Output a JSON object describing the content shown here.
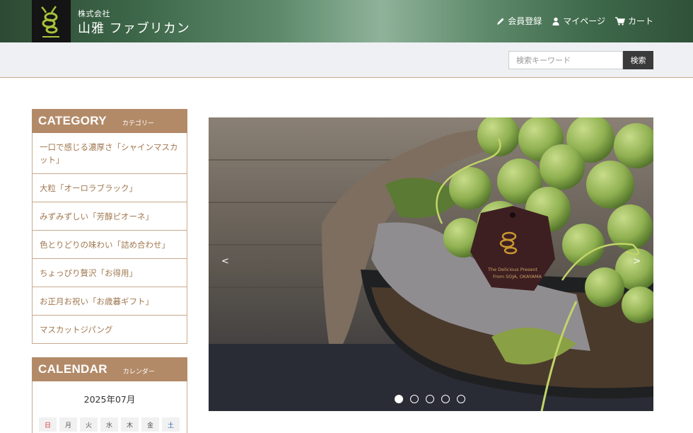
{
  "header": {
    "company_small": "株式会社",
    "company_name": "山雅 ファブリカン",
    "nav": [
      {
        "label": "会員登録",
        "icon": "pencil-icon"
      },
      {
        "label": "マイページ",
        "icon": "user-icon"
      },
      {
        "label": "カート",
        "icon": "cart-icon"
      }
    ]
  },
  "search": {
    "placeholder": "検索キーワード",
    "button_label": "検索"
  },
  "category": {
    "title": "CATEGORY",
    "subtitle": "カテゴリー",
    "items": [
      "一口で感じる濃厚さ「シャインマスカット」",
      "大粒「オーロラブラック」",
      "みずみずしい「芳醇ピオーネ」",
      "色とりどりの味わい「詰め合わせ」",
      "ちょっぴり贅沢「お得用」",
      "お正月お祝い「お歳暮ギフト」",
      "マスカットジパング"
    ]
  },
  "calendar": {
    "title": "CALENDAR",
    "subtitle": "カレンダー",
    "month": "2025年07月",
    "weekdays": [
      "日",
      "月",
      "火",
      "水",
      "木",
      "金",
      "土"
    ]
  },
  "slider": {
    "prev_label": "<",
    "next_label": ">",
    "slide_count": 5,
    "active_index": 0,
    "tag_line1": "The Delicious Present",
    "tag_line2": "From SOJA, OKAYAMA"
  },
  "colors": {
    "accent": "#b38a68",
    "link": "#a07850",
    "border": "#c8aa8e",
    "search_button": "#3a3a3a"
  }
}
